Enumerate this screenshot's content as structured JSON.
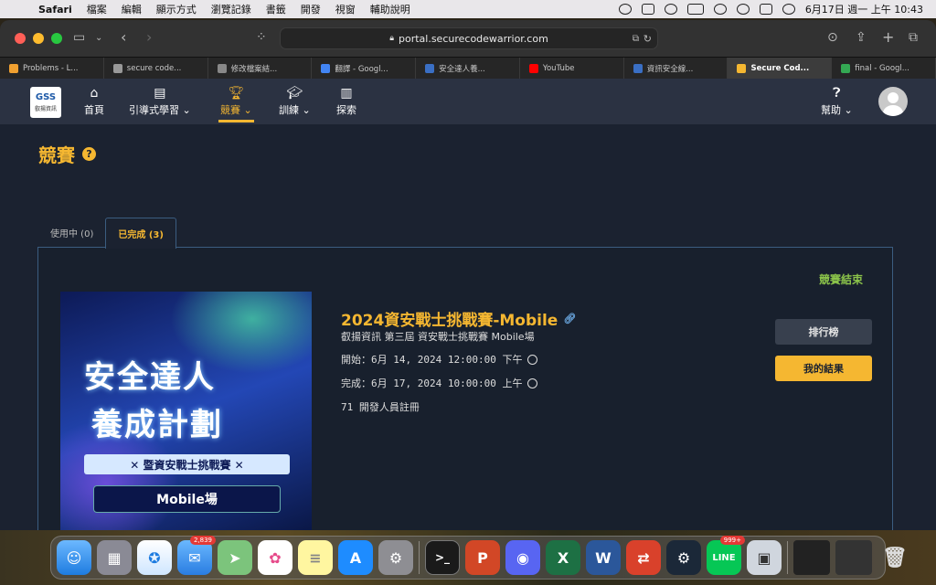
{
  "menubar": {
    "app": "Safari",
    "items": [
      "檔案",
      "編輯",
      "顯示方式",
      "瀏覽記錄",
      "書籤",
      "開發",
      "視窗",
      "輔助說明"
    ],
    "clock": "6月17日 週一 上午 10:43"
  },
  "browser": {
    "url": "portal.securecodewarrior.com",
    "tabs": [
      {
        "label": "Problems - L...",
        "color": "#f0a030"
      },
      {
        "label": "secure code...",
        "color": "#999999"
      },
      {
        "label": "修改檔案結...",
        "color": "#888888"
      },
      {
        "label": "翻譯 - Googl...",
        "color": "#4285f4"
      },
      {
        "label": "安全達人養...",
        "color": "#3a6fc4"
      },
      {
        "label": "YouTube",
        "color": "#ff0000"
      },
      {
        "label": "資訊安全線...",
        "color": "#3a6fc4"
      },
      {
        "label": "Secure Cod...",
        "color": "#f5b731",
        "active": true
      },
      {
        "label": "final - Googl...",
        "color": "#34a853"
      }
    ]
  },
  "nav": {
    "logo_main": "GSS",
    "logo_sub": "叡揚資訊",
    "home": "首頁",
    "guided": "引導式學習",
    "compete": "競賽",
    "train": "訓練",
    "explore": "探索",
    "help": "幫助"
  },
  "page": {
    "title": "競賽",
    "tab_active_inactive": "使用中 (0)",
    "tab_completed": "已完成 (3)"
  },
  "competition": {
    "status": "競賽結束",
    "title": "2024資安戰士挑戰賽-Mobile",
    "subtitle": "叡揚資訊 第三屆 資安戰士挑戰賽 Mobile場",
    "start": "開始：6月 14, 2024 12:00:00 下午",
    "end": "完成：6月 17, 2024 10:00:00 上午",
    "registered": "71 開發人員註冊",
    "leaderboard_button": "排行榜",
    "results_button": "我的結果",
    "banner_line1": "安全達人",
    "banner_line2": "養成計劃",
    "banner_line3": "✕ 暨資安戰士挑戰賽 ✕",
    "banner_line4": "Mobile場"
  },
  "dock": {
    "mail_badge": "2,839",
    "line_badge": "999+",
    "line_label": "LINE"
  }
}
